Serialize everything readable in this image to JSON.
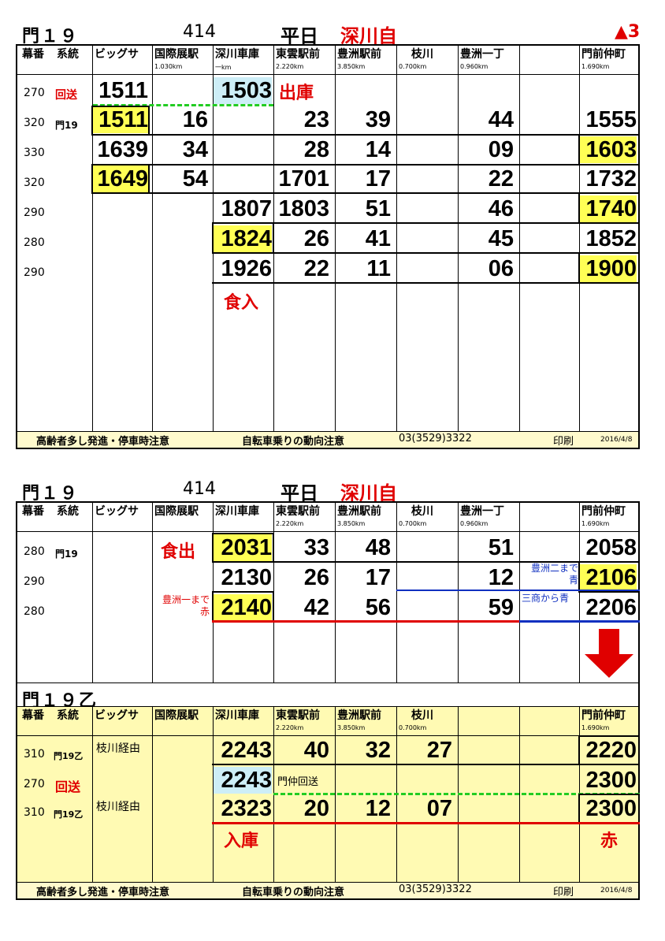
{
  "colors": {
    "highlight_yellow": "#ffff55",
    "highlight_cyan": "#cdeef7",
    "red": "#e00000",
    "blue": "#1030c0",
    "green_dash": "#22cc22",
    "footer_bg": "#fffacd",
    "panel3_bg": "#fffab3"
  },
  "panel1": {
    "route": "門１９",
    "number": "414",
    "day": "平日",
    "depot": "深川自",
    "mark": "▲3",
    "headers": [
      "幕番",
      "系統",
      "ビッグサ",
      "国際展駅",
      "深川車庫",
      "東雲駅前",
      "豊洲駅前",
      "枝川",
      "豊洲一丁",
      "",
      "門前仲町"
    ],
    "km": [
      "1.030km",
      "一km",
      "2.220km",
      "3.850km",
      "0.700km",
      "0.960km",
      "1.690km"
    ],
    "rows": [
      {
        "maku": "270",
        "keitou": "回送",
        "big": "1511",
        "fukagawa": "1503",
        "note": "出庫"
      },
      {
        "maku": "320",
        "keitou": "門19",
        "big": "1511",
        "kokusai": "16",
        "shinonome": "23",
        "toyosu": "39",
        "itchome": "44",
        "monzen": "1555"
      },
      {
        "maku": "330",
        "big": "1639",
        "kokusai": "34",
        "shinonome": "28",
        "toyosu": "14",
        "itchome": "09",
        "monzen": "1603"
      },
      {
        "maku": "320",
        "big": "1649",
        "kokusai": "54",
        "shinonome": "1701",
        "toyosu": "17",
        "itchome": "22",
        "monzen": "1732"
      },
      {
        "maku": "290",
        "fukagawa": "1807",
        "shinonome": "1803",
        "toyosu": "51",
        "itchome": "46",
        "monzen": "1740"
      },
      {
        "maku": "280",
        "fukagawa": "1824",
        "shinonome": "26",
        "toyosu": "41",
        "itchome": "45",
        "monzen": "1852"
      },
      {
        "maku": "290",
        "fukagawa": "1926",
        "shinonome": "22",
        "toyosu": "11",
        "itchome": "06",
        "monzen": "1900"
      }
    ],
    "note_eat_in": "食入",
    "footer": {
      "caution1": "高齢者多し発進・停車時注意",
      "caution2": "自転車乗りの動向注意",
      "phone": "03(3529)3322",
      "print": "印刷",
      "date": "2016/4/8"
    }
  },
  "panel2": {
    "route": "門１９",
    "number": "414",
    "day": "平日",
    "depot": "深川自",
    "headers": [
      "幕番",
      "系統",
      "ビッグサ",
      "国際展駅",
      "深川車庫",
      "東雲駅前",
      "豊洲駅前",
      "枝川",
      "豊洲一丁",
      "",
      "門前仲町"
    ],
    "km": [
      "2.220km",
      "3.850km",
      "0.700km",
      "0.960km",
      "1.690km"
    ],
    "rows": [
      {
        "maku": "280",
        "keitou": "門19",
        "note": "食出",
        "fukagawa": "2031",
        "shinonome": "33",
        "toyosu": "48",
        "itchome": "51",
        "monzen": "2058"
      },
      {
        "maku": "290",
        "fukagawa": "2130",
        "shinonome": "26",
        "toyosu": "17",
        "itchome": "12",
        "monzen": "2106",
        "blue_note": "豊洲二まで青"
      },
      {
        "maku": "280",
        "red_note": "豊洲一まで赤",
        "fukagawa": "2140",
        "shinonome": "42",
        "toyosu": "56",
        "itchome": "59",
        "monzen": "2206",
        "blue_note": "三商から青"
      }
    ]
  },
  "panel3": {
    "route": "門１９乙",
    "headers": [
      "幕番",
      "系統",
      "ビッグサ",
      "国際展駅",
      "深川車庫",
      "東雲駅前",
      "豊洲駅前",
      "枝川",
      "",
      "",
      "門前仲町"
    ],
    "km": [
      "2.220km",
      "3.850km",
      "0.700km",
      "1.690km"
    ],
    "rows": [
      {
        "maku": "310",
        "keitou": "門19乙",
        "via": "枝川経由",
        "fukagawa": "2243",
        "shinonome": "40",
        "toyosu": "32",
        "edagawa": "27",
        "monzen": "2220"
      },
      {
        "maku": "270",
        "keitou": "回送",
        "fukagawa": "2243",
        "note": "門仲回送",
        "monzen": "2300"
      },
      {
        "maku": "310",
        "keitou": "門19乙",
        "via": "枝川経由",
        "fukagawa": "2323",
        "shinonome": "20",
        "toyosu": "12",
        "edagawa": "07",
        "monzen": "2300"
      }
    ],
    "note_depot_in": "入庫",
    "note_red": "赤",
    "footer": {
      "caution1": "高齢者多し発進・停車時注意",
      "caution2": "自転車乗りの動向注意",
      "phone": "03(3529)3322",
      "print": "印刷",
      "date": "2016/4/8"
    }
  }
}
